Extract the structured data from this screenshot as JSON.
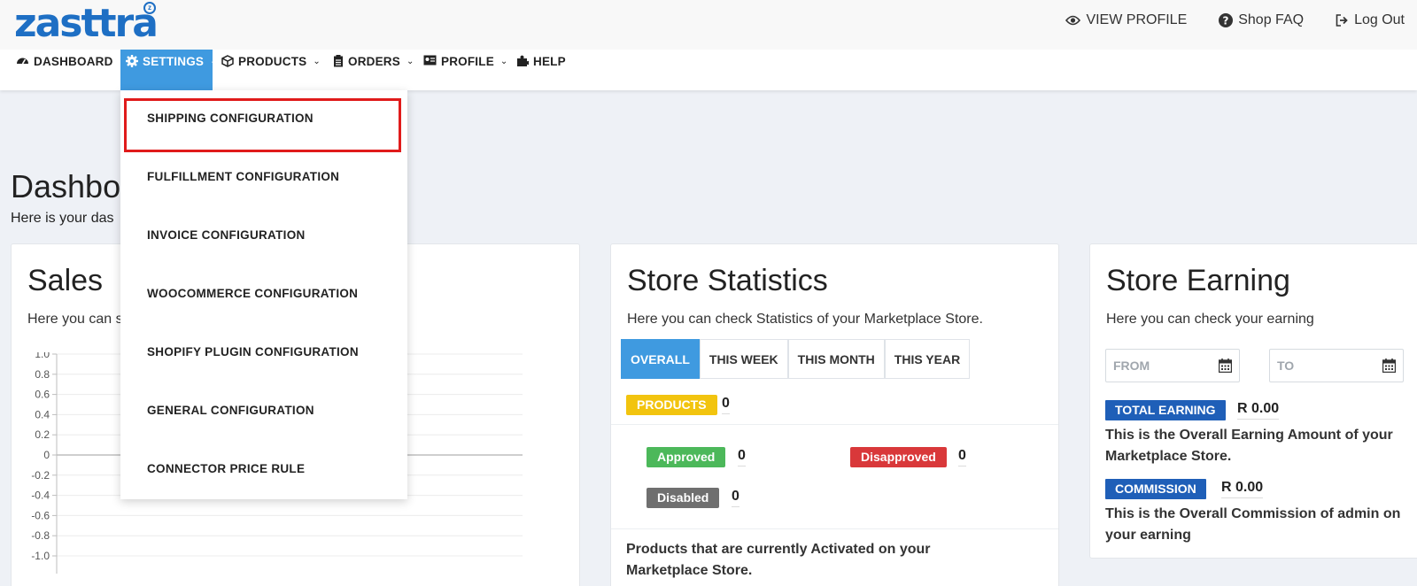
{
  "brand": {
    "logo_text": "zasttra",
    "logo_mark": "z"
  },
  "top_links": [
    {
      "label": "VIEW PROFILE",
      "icon": "eye-icon"
    },
    {
      "label": "Shop FAQ",
      "icon": "question-circle-icon"
    },
    {
      "label": "Log Out",
      "icon": "sign-out-icon"
    }
  ],
  "nav": [
    {
      "label": "DASHBOARD",
      "icon": "dashboard-icon",
      "has_menu": false
    },
    {
      "label": "SETTINGS",
      "icon": "gear-icon",
      "has_menu": true,
      "active": true
    },
    {
      "label": "PRODUCTS",
      "icon": "cube-icon",
      "has_menu": true
    },
    {
      "label": "ORDERS",
      "icon": "clipboard-icon",
      "has_menu": true
    },
    {
      "label": "PROFILE",
      "icon": "id-card-icon",
      "has_menu": true
    },
    {
      "label": "HELP",
      "icon": "puzzle-icon",
      "has_menu": false
    }
  ],
  "settings_menu": [
    "SHIPPING CONFIGURATION",
    "FULFILLMENT CONFIGURATION",
    "INVOICE CONFIGURATION",
    "WOOCOMMERCE CONFIGURATION",
    "SHOPIFY PLUGIN CONFIGURATION",
    "GENERAL CONFIGURATION",
    "CONNECTOR PRICE RULE"
  ],
  "page": {
    "title_visible": "Dashbo",
    "subtitle_visible": "Here is your das"
  },
  "sales": {
    "title": "Sales",
    "subtitle_visible": "Here you can s"
  },
  "chart_data": {
    "type": "line",
    "title": "",
    "xlabel": "",
    "ylabel": "",
    "ylim": [
      -1.0,
      1.0
    ],
    "y_ticks": [
      "1.0",
      "0.8",
      "0.6",
      "0.4",
      "0.2",
      "0",
      "-0.2",
      "-0.4",
      "-0.6",
      "-0.8",
      "-1.0"
    ],
    "series": [],
    "grid": true
  },
  "stats": {
    "title": "Store Statistics",
    "subtitle": "Here you can check Statistics of your Marketplace Store.",
    "tabs": [
      "OVERALL",
      "THIS WEEK",
      "THIS MONTH",
      "THIS YEAR"
    ],
    "products_label": "PRODUCTS",
    "products_count": "0",
    "approved_label": "Approved",
    "approved_count": "0",
    "disapproved_label": "Disapproved",
    "disapproved_count": "0",
    "disabled_label": "Disabled",
    "disabled_count": "0",
    "note": "Products that are currently Activated on your Marketplace Store.",
    "colors": {
      "products": "#f2c40f",
      "approved": "#4cb85a",
      "disapproved": "#d9383a",
      "disabled": "#6f6f6f"
    }
  },
  "earning": {
    "title": "Store Earning",
    "subtitle": "Here you can check your earning",
    "from_placeholder": "FROM",
    "to_placeholder": "TO",
    "total_label": "TOTAL EARNING",
    "total_value": "R 0.00",
    "total_note": "This is the Overall Earning Amount of your Marketplace Store.",
    "commission_label": "COMMISSION",
    "commission_value": "R 0.00",
    "commission_note": "This is the Overall Commission of admin on your earning"
  }
}
